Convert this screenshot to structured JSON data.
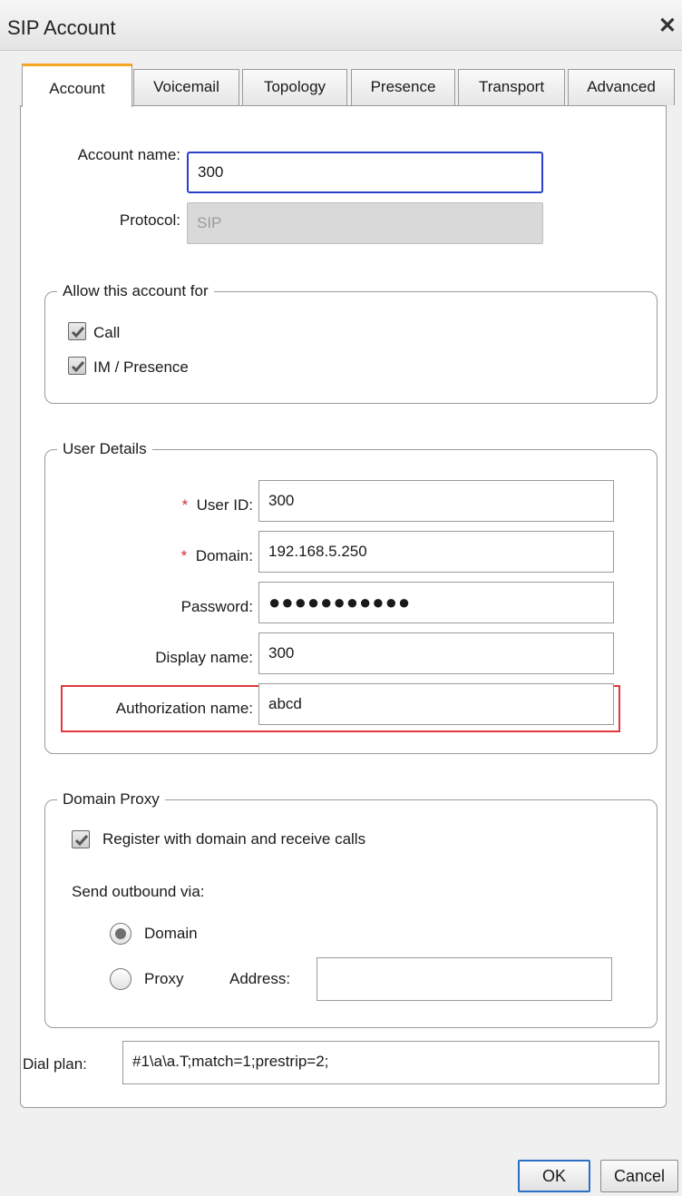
{
  "window": {
    "title": "SIP Account",
    "close_glyph": "✕"
  },
  "tabs": [
    "Account",
    "Voicemail",
    "Topology",
    "Presence",
    "Transport",
    "Advanced"
  ],
  "account": {
    "name_label": "Account name:",
    "name_value": "300",
    "protocol_label": "Protocol:",
    "protocol_value": "SIP"
  },
  "allow_group": {
    "legend": "Allow this account for",
    "call_label": "Call",
    "call_checked": true,
    "im_label": "IM / Presence",
    "im_checked": true
  },
  "user_details": {
    "legend": "User Details",
    "required_mark": "*",
    "user_id_label": "User ID:",
    "user_id_value": "300",
    "domain_label": "Domain:",
    "domain_value": "192.168.5.250",
    "password_label": "Password:",
    "password_value": "●●●●●●●●●●●",
    "display_name_label": "Display name:",
    "display_name_value": "300",
    "auth_name_label": "Authorization name:",
    "auth_name_value": "abcd"
  },
  "domain_proxy": {
    "legend": "Domain Proxy",
    "register_label": "Register with domain and receive calls",
    "register_checked": true,
    "send_outbound_label": "Send outbound via:",
    "domain_option": "Domain",
    "proxy_option": "Proxy",
    "selected": "Domain",
    "address_label": "Address:",
    "address_value": ""
  },
  "dial_plan": {
    "label": "Dial plan:",
    "value": "#1\\a\\a.T;match=1;prestrip=2;"
  },
  "buttons": {
    "ok": "OK",
    "cancel": "Cancel"
  },
  "colors": {
    "accent_tab": "#f5a623",
    "focus_border": "#2b3fc7",
    "highlight_border": "#e0383e",
    "required": "#d32f2f"
  }
}
